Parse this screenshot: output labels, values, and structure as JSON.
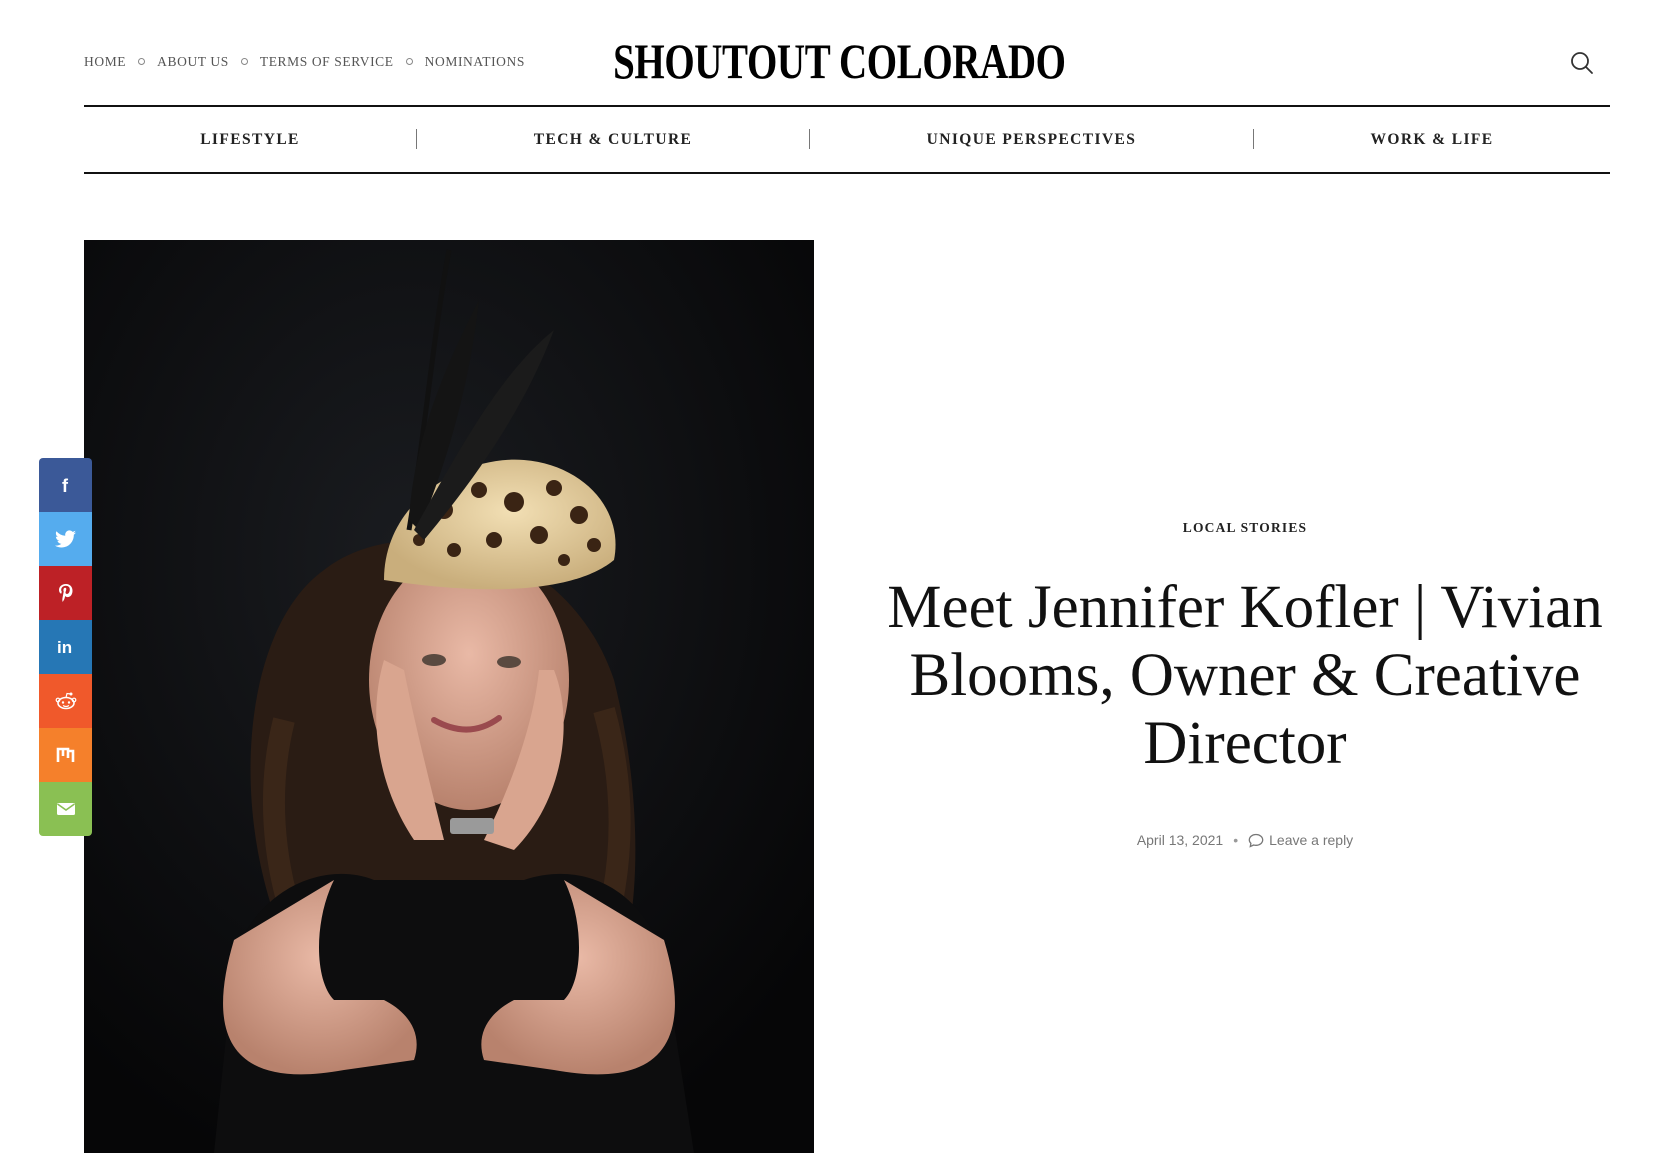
{
  "header": {
    "top_links": [
      "HOME",
      "ABOUT US",
      "TERMS OF SERVICE",
      "NOMINATIONS"
    ],
    "logo": "SHOUTOUT COLORADO",
    "search_icon": "search-icon"
  },
  "categories": [
    "LIFESTYLE",
    "TECH & CULTURE",
    "UNIQUE PERSPECTIVES",
    "WORK & LIFE"
  ],
  "share": [
    {
      "name": "facebook",
      "icon": "facebook-icon",
      "color": "#3b5998"
    },
    {
      "name": "twitter",
      "icon": "twitter-icon",
      "color": "#55acee"
    },
    {
      "name": "pinterest",
      "icon": "pinterest-icon",
      "color": "#bd2126"
    },
    {
      "name": "linkedin",
      "icon": "linkedin-icon",
      "color": "#2677b5"
    },
    {
      "name": "reddit",
      "icon": "reddit-icon",
      "color": "#f0592b"
    },
    {
      "name": "mix",
      "icon": "mix-icon",
      "color": "#f5802b"
    },
    {
      "name": "email",
      "icon": "email-icon",
      "color": "#8ac053"
    }
  ],
  "article": {
    "category": "LOCAL STORIES",
    "title": "Meet Jennifer Kofler | Vivian Blooms, Owner & Creative Director",
    "date": "April 13, 2021",
    "separator": "•",
    "reply": "Leave a reply"
  }
}
